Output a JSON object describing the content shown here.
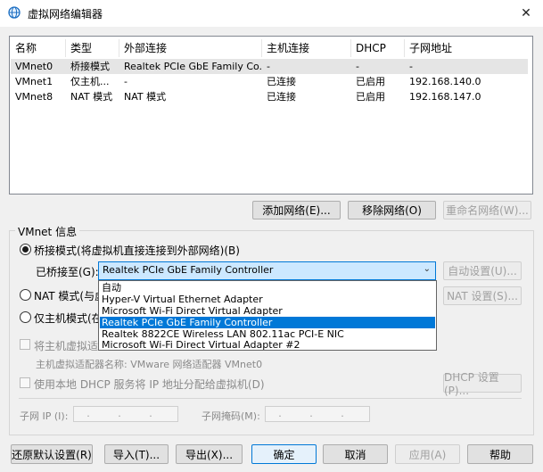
{
  "window": {
    "title": "虚拟网络编辑器",
    "close_glyph": "✕"
  },
  "list": {
    "columns": [
      "名称",
      "类型",
      "外部连接",
      "主机连接",
      "DHCP",
      "子网地址"
    ],
    "rows": [
      [
        "VMnet0",
        "桥接模式",
        "Realtek PCIe GbE Family Co...",
        "-",
        "-",
        "-"
      ],
      [
        "VMnet1",
        "仅主机...",
        "-",
        "已连接",
        "已启用",
        "192.168.140.0"
      ],
      [
        "VMnet8",
        "NAT 模式",
        "NAT 模式",
        "已连接",
        "已启用",
        "192.168.147.0"
      ]
    ]
  },
  "list_buttons": {
    "add": "添加网络(E)...",
    "remove": "移除网络(O)",
    "rename": "重命名网络(W)..."
  },
  "vmnet_info": {
    "legend": "VMnet 信息",
    "bridged_label": "桥接模式(将虚拟机直接连接到外部网络)(B)",
    "bridged_to_label": "已桥接至(G):",
    "bridged_to_value": "Realtek PCIe GbE Family Controller",
    "auto_settings": "自动设置(U)...",
    "nat_label": "NAT 模式(与虚",
    "nat_settings": "NAT 设置(S)...",
    "host_only_label": "仅主机模式(在",
    "connect_host_adapter": "将主机虚拟适",
    "host_adapter_name": "主机虚拟适配器名称: VMware 网络适配器 VMnet0",
    "use_dhcp": "使用本地 DHCP 服务将 IP 地址分配给虚拟机(D)",
    "dhcp_settings": "DHCP 设置(P)...",
    "subnet_ip_label": "子网 IP (I):",
    "subnet_ip_value": ". . .",
    "subnet_mask_label": "子网掩码(M):",
    "subnet_mask_value": ". . ."
  },
  "dropdown_options": [
    "自动",
    "Hyper-V Virtual Ethernet Adapter",
    "Microsoft Wi-Fi Direct Virtual Adapter",
    "Realtek PCIe GbE Family Controller",
    "Realtek 8822CE Wireless LAN 802.11ac PCI-E NIC",
    "Microsoft Wi-Fi Direct Virtual Adapter #2"
  ],
  "selected_option_index": 3,
  "bottom_buttons": {
    "restore": "还原默认设置(R)",
    "import": "导入(T)...",
    "export": "导出(X)...",
    "ok": "确定",
    "cancel": "取消",
    "apply": "应用(A)",
    "help": "帮助"
  },
  "colors": {
    "accent": "#0078d7",
    "selection_bg": "#cce8ff"
  }
}
